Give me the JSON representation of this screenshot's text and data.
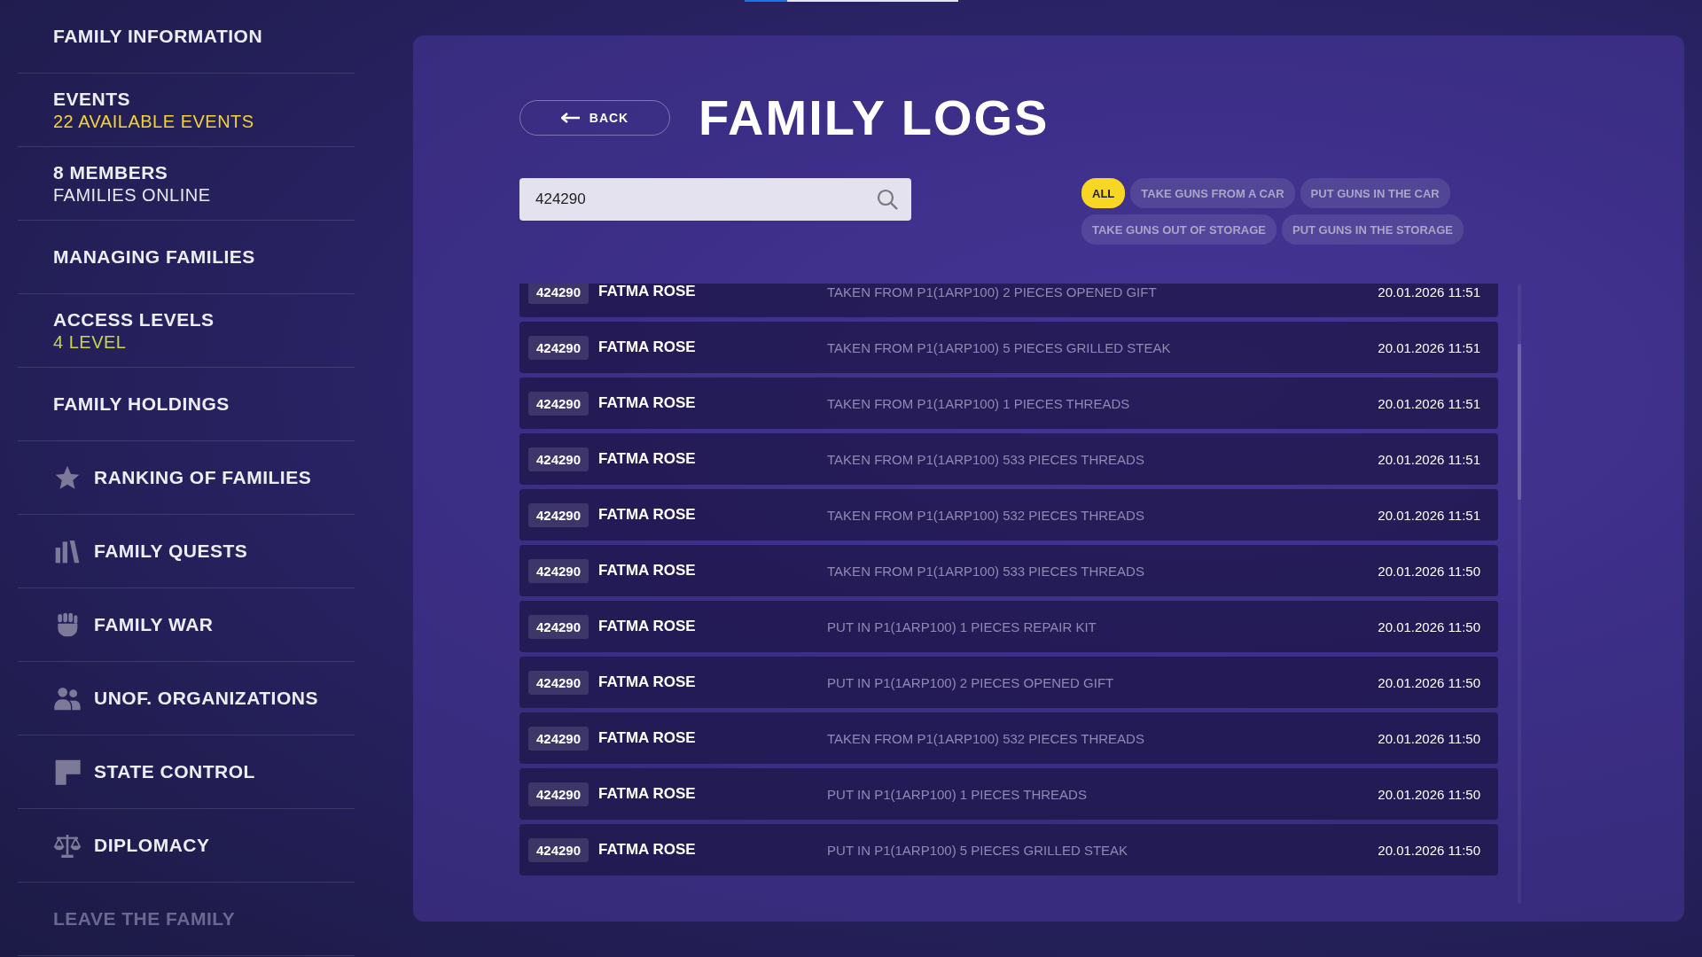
{
  "progress": {
    "level": 0.2
  },
  "sidebar": {
    "items": [
      {
        "kind": "text",
        "title": "FAMILY INFORMATION",
        "disabled": false
      },
      {
        "kind": "text",
        "title": "EVENTS",
        "subtitle": {
          "text": "22 AVAILABLE EVENTS",
          "color": "#f2d23a"
        },
        "disabled": false
      },
      {
        "kind": "text",
        "title": "8 MEMBERS",
        "subtitle": {
          "text": "FAMILIES ONLINE",
          "color": "#e8e8f0"
        },
        "disabled": false
      },
      {
        "kind": "text",
        "title": "MANAGING FAMILIES",
        "disabled": false
      },
      {
        "kind": "text",
        "title": "ACCESS LEVELS",
        "subtitle": {
          "text": "4 LEVEL",
          "color": "#c9d64a"
        },
        "disabled": false
      },
      {
        "kind": "text",
        "title": "FAMILY HOLDINGS",
        "disabled": false
      },
      {
        "kind": "star",
        "title": "RANKING OF FAMILIES",
        "disabled": false
      },
      {
        "kind": "bars",
        "title": "FAMILY QUESTS",
        "disabled": false
      },
      {
        "kind": "fist",
        "title": "FAMILY WAR",
        "disabled": false
      },
      {
        "kind": "people",
        "title": "UNOF. ORGANIZATIONS",
        "disabled": false
      },
      {
        "kind": "flag",
        "title": "STATE CONTROL",
        "disabled": false
      },
      {
        "kind": "scales",
        "title": "DIPLOMACY",
        "disabled": false
      },
      {
        "kind": "text",
        "title": "LEAVE THE FAMILY",
        "disabled": true
      }
    ]
  },
  "header": {
    "back": "BACK",
    "title": "FAMILY LOGS"
  },
  "search": {
    "value": "424290"
  },
  "filters": [
    {
      "label": "ALL",
      "selected": true
    },
    {
      "label": "TAKE GUNS FROM A CAR",
      "selected": false
    },
    {
      "label": "PUT GUNS IN THE CAR",
      "selected": false
    },
    {
      "label": "TAKE GUNS OUT OF STORAGE",
      "selected": false
    },
    {
      "label": "PUT GUNS IN THE STORAGE",
      "selected": false
    }
  ],
  "logs": [
    {
      "id": "424290",
      "name": "FATMA ROSE",
      "action": "TAKEN FROM P1(1ARP100) 2 PIECES OPENED GIFT",
      "time": "20.01.2026 11:51"
    },
    {
      "id": "424290",
      "name": "FATMA ROSE",
      "action": "TAKEN FROM P1(1ARP100) 5 PIECES GRILLED STEAK",
      "time": "20.01.2026 11:51"
    },
    {
      "id": "424290",
      "name": "FATMA ROSE",
      "action": "TAKEN FROM P1(1ARP100) 1 PIECES THREADS",
      "time": "20.01.2026 11:51"
    },
    {
      "id": "424290",
      "name": "FATMA ROSE",
      "action": "TAKEN FROM P1(1ARP100) 533 PIECES THREADS",
      "time": "20.01.2026 11:51"
    },
    {
      "id": "424290",
      "name": "FATMA ROSE",
      "action": "TAKEN FROM P1(1ARP100) 532 PIECES THREADS",
      "time": "20.01.2026 11:51"
    },
    {
      "id": "424290",
      "name": "FATMA ROSE",
      "action": "TAKEN FROM P1(1ARP100) 533 PIECES THREADS",
      "time": "20.01.2026 11:50"
    },
    {
      "id": "424290",
      "name": "FATMA ROSE",
      "action": "PUT IN P1(1ARP100) 1 PIECES REPAIR KIT",
      "time": "20.01.2026 11:50"
    },
    {
      "id": "424290",
      "name": "FATMA ROSE",
      "action": "PUT IN P1(1ARP100) 2 PIECES OPENED GIFT",
      "time": "20.01.2026 11:50"
    },
    {
      "id": "424290",
      "name": "FATMA ROSE",
      "action": "TAKEN FROM P1(1ARP100) 532 PIECES THREADS",
      "time": "20.01.2026 11:50"
    },
    {
      "id": "424290",
      "name": "FATMA ROSE",
      "action": "PUT IN P1(1ARP100) 1 PIECES THREADS",
      "time": "20.01.2026 11:50"
    },
    {
      "id": "424290",
      "name": "FATMA ROSE",
      "action": "PUT IN P1(1ARP100) 5 PIECES GRILLED STEAK",
      "time": "20.01.2026 11:50"
    }
  ]
}
